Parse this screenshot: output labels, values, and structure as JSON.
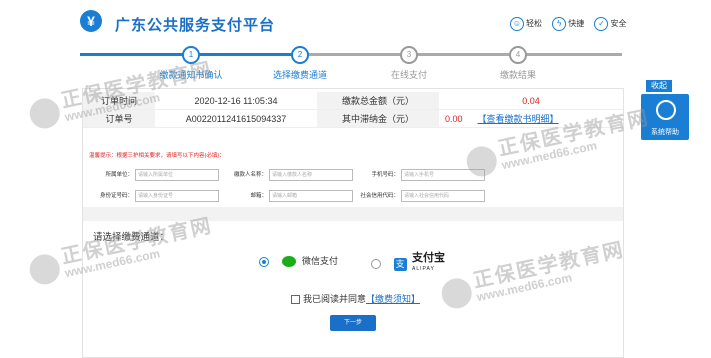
{
  "header": {
    "logo_glyph": "¥",
    "title": "广东公共服务支付平台",
    "links": [
      {
        "label": "轻松",
        "icon": "smile-icon"
      },
      {
        "label": "快捷",
        "icon": "lightning-icon"
      },
      {
        "label": "安全",
        "icon": "shield-icon"
      }
    ]
  },
  "steps": [
    {
      "num": "1",
      "label": "缴款通知书确认"
    },
    {
      "num": "2",
      "label": "选择缴费通道"
    },
    {
      "num": "3",
      "label": "在线支付"
    },
    {
      "num": "4",
      "label": "缴款结果"
    }
  ],
  "order": {
    "time_label": "订单时间",
    "time_value": "2020-12-16 11:05:34",
    "total_label": "缴款总金额（元）",
    "total_value": "0.04",
    "no_label": "订单号",
    "no_value": "A0022011241615094337",
    "late_label": "其中滞纳金（元）",
    "late_value": "0.00",
    "detail_link": "【查看缴款书明细】"
  },
  "notice": "温馨提示：根据三护相关要求，请填写以下内容(必填)：",
  "form": {
    "unit_label": "所属单位：",
    "unit_ph": "请输入所属单位",
    "payer_label": "缴款人名称：",
    "payer_ph": "请输入缴款人名称",
    "phone_label": "手机号码：",
    "phone_ph": "请输入手机号",
    "id_label": "身份证号码：",
    "id_ph": "请输入身份证号",
    "email_label": "邮箱：",
    "email_ph": "请输入邮箱",
    "credit_label": "社会信用代码：",
    "credit_ph": "请输入社会信用代码"
  },
  "payment": {
    "choose_label": "请选择缴费通道：",
    "wechat_label": "微信支付",
    "alipay_glyph": "支",
    "alipay_main": "支付宝",
    "alipay_sub": "ALIPAY"
  },
  "agree": {
    "text": "我已阅读并同意",
    "link": "【缴费须知】"
  },
  "next_button": "下一步",
  "side": {
    "tab": "收起",
    "label": "系统帮助"
  },
  "watermark": {
    "main": "正保医学教育网",
    "url": "www.med66.com"
  },
  "colors": {
    "brand": "#1a7fd4",
    "red": "#e02020",
    "wechat": "#1aad19"
  }
}
